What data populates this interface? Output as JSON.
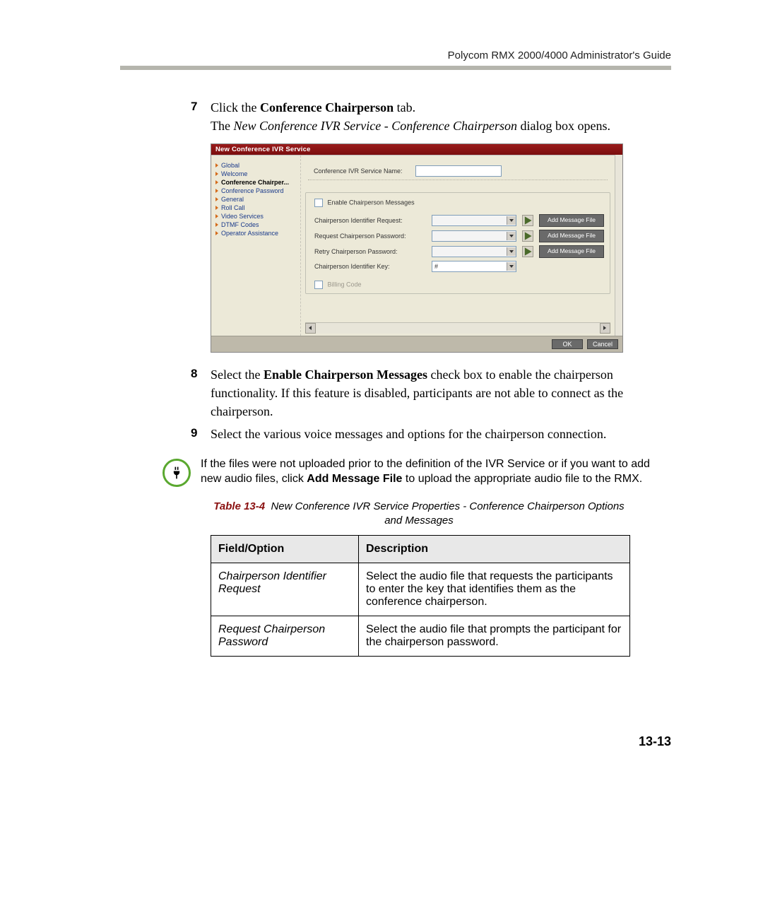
{
  "header": "Polycom RMX 2000/4000 Administrator's Guide",
  "steps": {
    "s7": {
      "num": "7",
      "line1_pre": "Click the ",
      "line1_bold": "Conference Chairperson",
      "line1_post": " tab.",
      "line2_pre": "The ",
      "line2_italic": "New Conference IVR Service - Conference Chairperson",
      "line2_post": " dialog box opens."
    },
    "s8": {
      "num": "8",
      "pre": "Select the ",
      "bold": "Enable Chairperson Messages",
      "post": " check box to enable the chairperson functionality. If this feature is disabled, participants are not able to connect as the chairperson."
    },
    "s9": {
      "num": "9",
      "text": "Select the various voice messages and options for the chairperson connection."
    }
  },
  "shot": {
    "title": "New Conference IVR Service",
    "nav": [
      "Global",
      "Welcome",
      "Conference Chairper...",
      "Conference Password",
      "General",
      "Roll Call",
      "Video Services",
      "DTMF Codes",
      "Operator Assistance"
    ],
    "nav_active_index": 2,
    "svc_name_label": "Conference IVR Service Name:",
    "enable_label": "Enable Chairperson Messages",
    "rows": [
      {
        "label": "Chairperson Identifier Request:",
        "btn": "Add Message File"
      },
      {
        "label": "Request Chairperson Password:",
        "btn": "Add Message File"
      },
      {
        "label": "Retry Chairperson Password:",
        "btn": "Add Message File"
      }
    ],
    "id_key_label": "Chairperson Identifier Key:",
    "id_key_value": "#",
    "billing_label": "Billing Code",
    "ok": "OK",
    "cancel": "Cancel"
  },
  "note": {
    "pre": "If the files were not uploaded prior to the definition of the IVR Service or if you want to add new audio files, click ",
    "bold": "Add Message File",
    "post": " to upload the appropriate audio file to the RMX."
  },
  "table": {
    "caption_bold": "Table 13-4",
    "caption_rest": "New Conference IVR Service Properties - Conference Chairperson Options and Messages",
    "h1": "Field/Option",
    "h2": "Description",
    "r1_f": "Chairperson Identifier Request",
    "r1_d": "Select the audio file that requests the participants to enter the key that identifies them as the conference chairperson.",
    "r2_f": "Request Chairperson Password",
    "r2_d": "Select the audio file that prompts the participant for the chairperson password."
  },
  "page_num": "13-13"
}
